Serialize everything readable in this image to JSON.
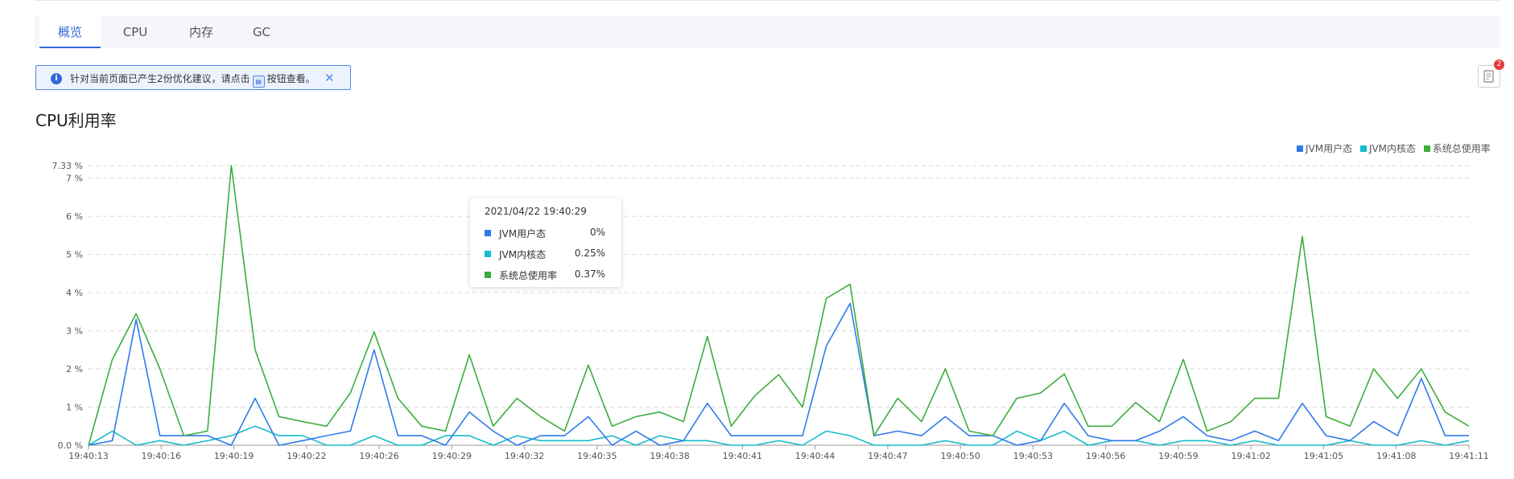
{
  "tabs": [
    {
      "label": "概览",
      "active": true
    },
    {
      "label": "CPU",
      "active": false
    },
    {
      "label": "内存",
      "active": false
    },
    {
      "label": "GC",
      "active": false
    }
  ],
  "alert": {
    "text_before": "针对当前页面已产生2份优化建议，请点击",
    "text_after": "按钮查看。",
    "info_icon": "info-icon",
    "close_icon": "close-icon"
  },
  "report_button": {
    "icon": "report-icon",
    "badge": "2"
  },
  "section_title": "CPU利用率",
  "colors": {
    "jvm_user": "#2f7bea",
    "jvm_kernel": "#16bccc",
    "system_total": "#3cad3c",
    "accent": "#2f6bd9"
  },
  "chart_data": {
    "type": "line",
    "title": "CPU利用率",
    "ylim": [
      0,
      7.33
    ],
    "y_ticks": [
      "0.0 %",
      "1 %",
      "2 %",
      "3 %",
      "4 %",
      "5 %",
      "6 %",
      "7 %",
      "7.33 %"
    ],
    "x_ticks": [
      "19:40:13",
      "19:40:16",
      "19:40:19",
      "19:40:22",
      "19:40:26",
      "19:40:29",
      "19:40:32",
      "19:40:35",
      "19:40:38",
      "19:40:41",
      "19:40:44",
      "19:40:47",
      "19:40:50",
      "19:40:53",
      "19:40:56",
      "19:40:59",
      "19:41:02",
      "19:41:05",
      "19:41:08",
      "19:41:11"
    ],
    "grid": true,
    "legend_position": "top-right",
    "series": [
      {
        "name": "JVM用户态",
        "values": [
          0,
          0.12,
          3.3,
          0.25,
          0.25,
          0.25,
          0,
          1.23,
          0,
          0.12,
          0.25,
          0.37,
          2.5,
          0.25,
          0.25,
          0,
          0.87,
          0.37,
          0,
          0.25,
          0.25,
          0.75,
          0,
          0.37,
          0,
          0.12,
          1.1,
          0.25,
          0.25,
          0.25,
          0.25,
          2.6,
          3.72,
          0.25,
          0.37,
          0.25,
          0.75,
          0.25,
          0.25,
          0,
          0.12,
          1.1,
          0.25,
          0.12,
          0.12,
          0.37,
          0.75,
          0.25,
          0.12,
          0.37,
          0.12,
          1.1,
          0.25,
          0.12,
          0.62,
          0.25,
          1.75,
          0.25,
          0.25
        ]
      },
      {
        "name": "JVM内核态",
        "values": [
          0,
          0.37,
          0,
          0.12,
          0,
          0.12,
          0.25,
          0.5,
          0.25,
          0.25,
          0,
          0,
          0.25,
          0,
          0,
          0.25,
          0.25,
          0,
          0.25,
          0.12,
          0.12,
          0.12,
          0.25,
          0,
          0.25,
          0.12,
          0.12,
          0,
          0,
          0.12,
          0,
          0.37,
          0.25,
          0,
          0,
          0,
          0.12,
          0,
          0,
          0.37,
          0.12,
          0.37,
          0,
          0.12,
          0.12,
          0,
          0.12,
          0.12,
          0,
          0.12,
          0,
          0,
          0,
          0.12,
          0,
          0,
          0.12,
          0,
          0.12
        ]
      },
      {
        "name": "系统总使用率",
        "values": [
          0,
          2.25,
          3.45,
          2,
          0.25,
          0.37,
          7.33,
          2.5,
          0.75,
          0.62,
          0.5,
          1.37,
          2.97,
          1.23,
          0.5,
          0.37,
          2.37,
          0.5,
          1.23,
          0.75,
          0.37,
          2.1,
          0.5,
          0.75,
          0.87,
          0.62,
          2.85,
          0.5,
          1.3,
          1.85,
          1,
          3.85,
          4.22,
          0.25,
          1.23,
          0.62,
          2,
          0.37,
          0.25,
          1.23,
          1.37,
          1.87,
          0.5,
          0.5,
          1.12,
          0.62,
          2.25,
          0.37,
          0.62,
          1.23,
          1.23,
          5.47,
          0.75,
          0.5,
          2,
          1.23,
          2,
          0.87,
          0.5
        ]
      }
    ],
    "tooltip": {
      "time": "2021/04/22 19:40:29",
      "rows": [
        {
          "name": "JVM用户态",
          "value": "0%"
        },
        {
          "name": "JVM内核态",
          "value": "0.25%"
        },
        {
          "name": "系统总使用率",
          "value": "0.37%"
        }
      ]
    }
  }
}
